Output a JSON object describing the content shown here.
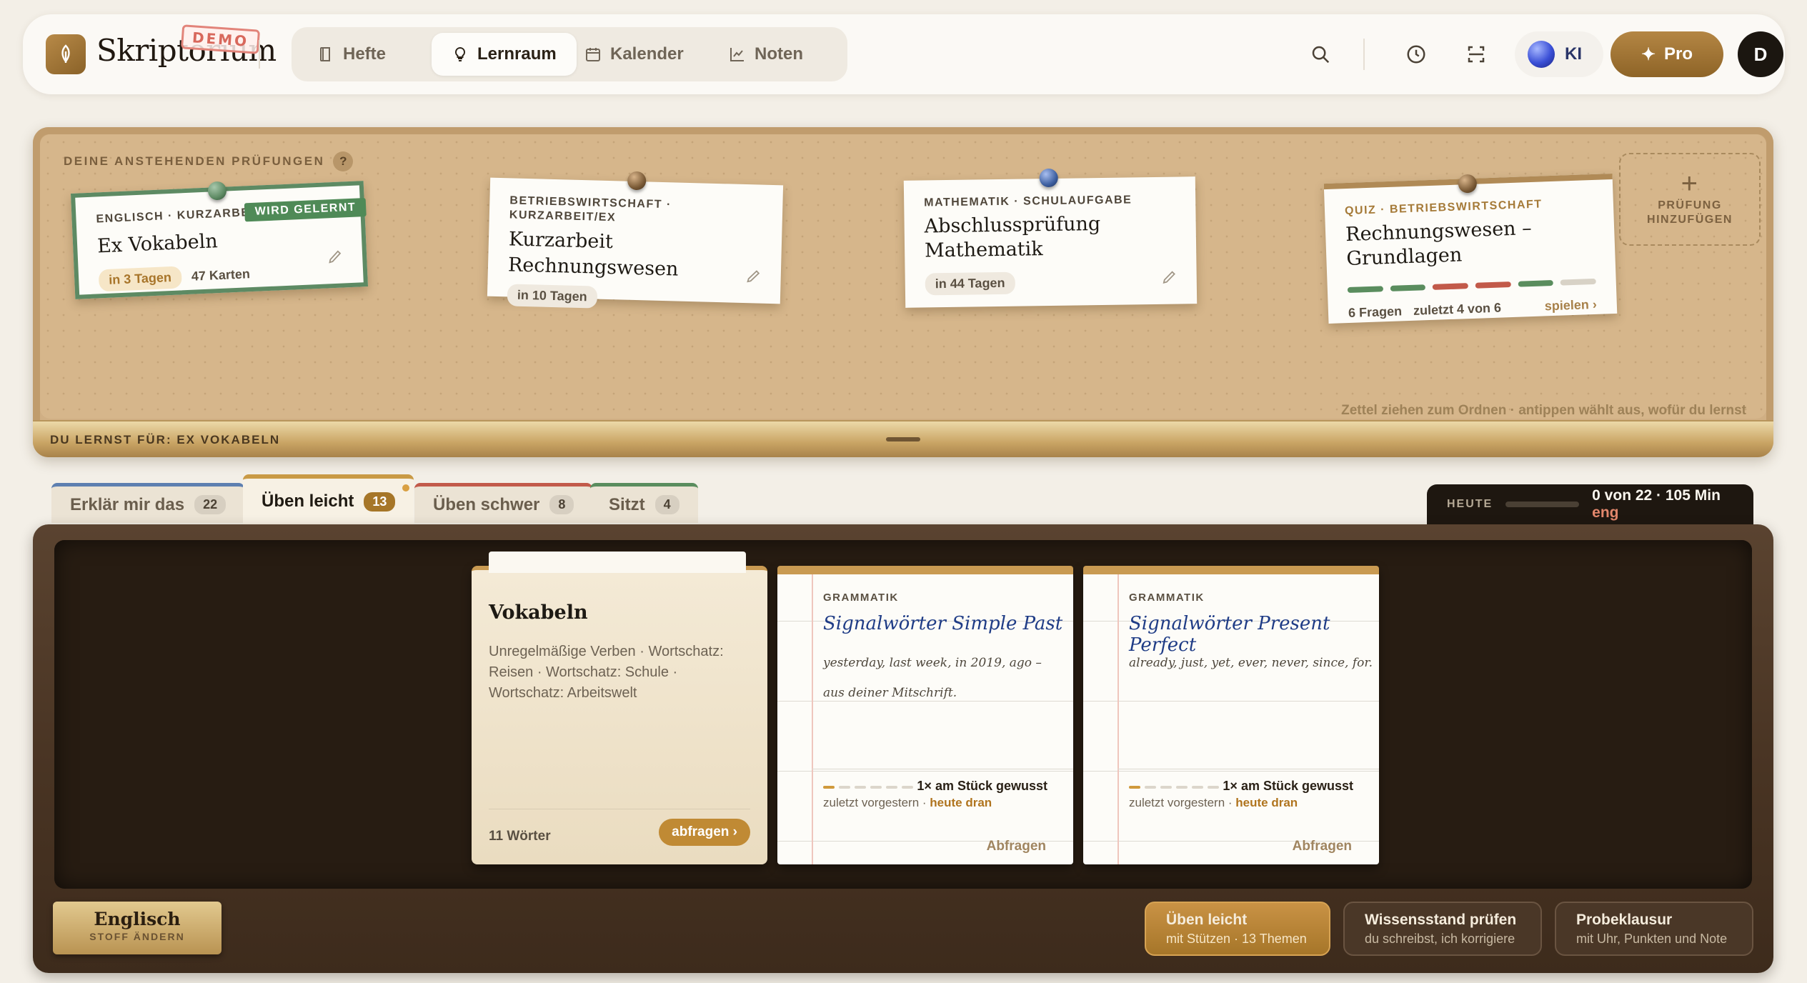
{
  "app": {
    "brand": "Skriptorium",
    "demo_badge": "DEMO"
  },
  "nav": {
    "tabs": [
      {
        "label": "Hefte",
        "icon": "book-icon"
      },
      {
        "label": "Lernraum",
        "icon": "lightbulb-icon",
        "active": true
      },
      {
        "label": "Kalender",
        "icon": "calendar-icon"
      },
      {
        "label": "Noten",
        "icon": "chart-icon"
      }
    ],
    "ki_label": "KI",
    "pro_label": "Pro",
    "avatar_initial": "D"
  },
  "board": {
    "heading": "DEINE ANSTEHENDEN PRÜFUNGEN",
    "help": "?",
    "hint": "Zettel ziehen zum Ordnen · antippen wählt aus, wofür du lernst",
    "footer_label": "DU LERNST FÜR: EX VOKABELN",
    "add_label_1": "PRÜFUNG",
    "add_label_2": "HINZUFÜGEN",
    "add_plus": "+",
    "notes": [
      {
        "category": "ENGLISCH · KURZARBEIT/EX",
        "title": "Ex Vokabeln",
        "due": "in 3 Tagen",
        "extra": "47 Karten",
        "badge": "WIRD GELERNT",
        "pin_color": "#5d8a63"
      },
      {
        "category": "BETRIEBSWIRTSCHAFT ·",
        "category2": "KURZARBEIT/EX",
        "title": "Kurzarbeit Rechnungswesen",
        "due": "in 10 Tagen",
        "pin_color": "#7a5a36"
      },
      {
        "category": "MATHEMATIK · SCHULAUFGABE",
        "title": "Abschlussprüfung",
        "title2": "Mathematik",
        "due": "in 44 Tagen",
        "pin_color": "#3d5fa0"
      },
      {
        "category": "QUIZ · BETRIEBSWIRTSCHAFT",
        "title": "Rechnungswesen –",
        "title2": "Grundlagen",
        "questions": "6 Fragen",
        "last": "zuletzt 4 von 6",
        "play": "spielen ›",
        "pin_color": "#7a5a36",
        "results": [
          "#5a8d5e",
          "#5a8d5e",
          "#c25a4a",
          "#c25a4a",
          "#5a8d5e",
          "#d8d2c6"
        ]
      }
    ]
  },
  "folder_tabs": [
    {
      "label": "Erklär mir das",
      "count": "22",
      "color": "#5d7fb0"
    },
    {
      "label": "Üben leicht",
      "count": "13",
      "color": "#c99a45",
      "active": true
    },
    {
      "label": "Üben schwer",
      "count": "8",
      "color": "#c25a4a"
    },
    {
      "label": "Sitzt",
      "count": "4",
      "color": "#5a8d5e"
    }
  ],
  "today": {
    "label": "HEUTE",
    "value": "0 von 22 · 105 Min",
    "tight": "eng"
  },
  "desk": {
    "stack": {
      "title": "Vokabeln",
      "subtitle": "Unregelmäßige Verben · Wortschatz: Reisen · Wortschatz: Schule · Wortschatz: Arbeitswelt",
      "count": "11 Wörter",
      "button": "abfragen ›"
    },
    "cards": [
      {
        "category": "GRAMMATIK",
        "title": "Signalwörter Simple Past",
        "line1": "yesterday, last week, in 2019, ago –",
        "line2": "aus deiner Mitschrift.",
        "known": "1× am Stück gewusst",
        "last_prefix": "zuletzt vorgestern · ",
        "last_due": "heute dran",
        "ask": "Abfragen"
      },
      {
        "category": "GRAMMATIK",
        "title": "Signalwörter Present Perfect",
        "line1": "already, just, yet, ever, never, since, for.",
        "line2": "",
        "known": "1× am Stück gewusst",
        "last_prefix": "zuletzt vorgestern · ",
        "last_due": "heute dran",
        "ask": "Abfragen"
      }
    ],
    "subject": {
      "name": "Englisch",
      "action": "STOFF ÄNDERN"
    },
    "modes": [
      {
        "title": "Üben leicht",
        "sub": "mit Stützen · 13 Themen",
        "active": true
      },
      {
        "title": "Wissensstand prüfen",
        "sub": "du schreibst, ich korrigiere"
      },
      {
        "title": "Probeklausur",
        "sub": "mit Uhr, Punkten und Note"
      }
    ]
  }
}
